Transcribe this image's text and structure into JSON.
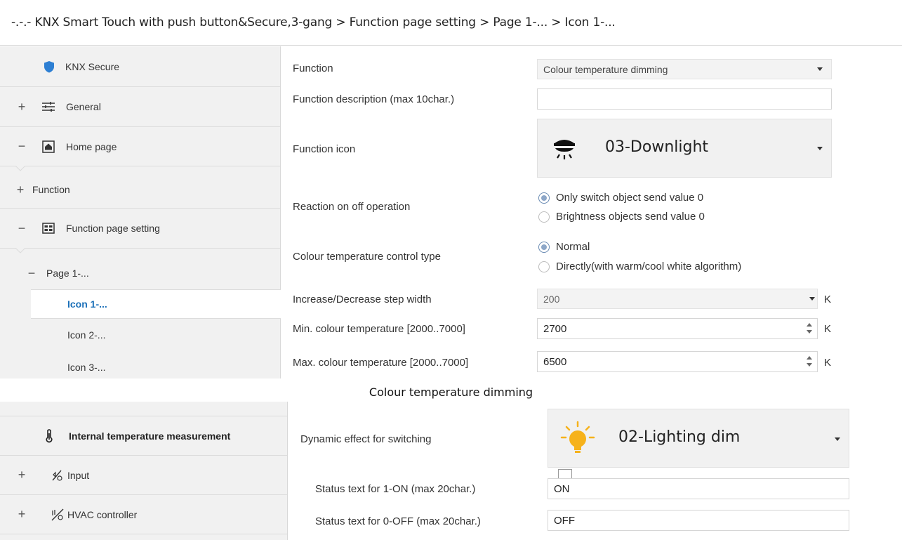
{
  "breadcrumb": "-.-.- KNX Smart Touch with push button&Secure,3-gang > Function page setting > Page 1-... > Icon 1-...",
  "sidebar_top": {
    "items": [
      {
        "label": "KNX Secure",
        "toggle": ""
      },
      {
        "label": "General",
        "toggle": "+"
      },
      {
        "label": "Home page",
        "toggle": "−"
      },
      {
        "label": "Function",
        "toggle": "+"
      },
      {
        "label": "Function page setting",
        "toggle": "−"
      },
      {
        "label": "Page 1-...",
        "toggle": "−"
      },
      {
        "label": "Icon 1-...",
        "toggle": ""
      },
      {
        "label": "Icon 2-...",
        "toggle": ""
      },
      {
        "label": "Icon 3-...",
        "toggle": ""
      }
    ]
  },
  "params": {
    "function_label": "Function",
    "function_value": "Colour temperature dimming",
    "description_label": "Function description (max 10char.)",
    "description_value": "",
    "icon_label": "Function icon",
    "icon_value": "03-Downlight",
    "reaction_label": "Reaction on off operation",
    "reaction_options": [
      "Only switch object send value 0",
      "Brightness objects send value 0"
    ],
    "ct_type_label": "Colour temperature control type",
    "ct_type_options": [
      "Normal",
      "Directly(with warm/cool white algorithm)"
    ],
    "step_label": "Increase/Decrease step width",
    "step_value": "200",
    "step_unit": "K",
    "min_label": "Min. colour temperature [2000..7000]",
    "min_value": "2700",
    "min_unit": "K",
    "max_label": "Max. colour temperature [2000..7000]",
    "max_value": "6500",
    "max_unit": "K"
  },
  "caption": "Colour temperature dimming",
  "sidebar_bottom": {
    "items": [
      {
        "label": "Internal temperature measurement",
        "toggle": ""
      },
      {
        "label": "Input",
        "toggle": "+"
      },
      {
        "label": "HVAC controller",
        "toggle": "+"
      }
    ]
  },
  "params_bottom": {
    "dynamic_label": "Dynamic effect for switching",
    "dynamic_value": "02-Lighting dim",
    "on_label": "Status text for 1-ON (max 20char.)",
    "on_value": "ON",
    "off_label": "Status text for 0-OFF (max 20char.)",
    "off_value": "OFF"
  },
  "colors": {
    "selected_text": "#1a6fb8",
    "shield": "#2d7fd3",
    "bulb": "#f6b21b"
  }
}
